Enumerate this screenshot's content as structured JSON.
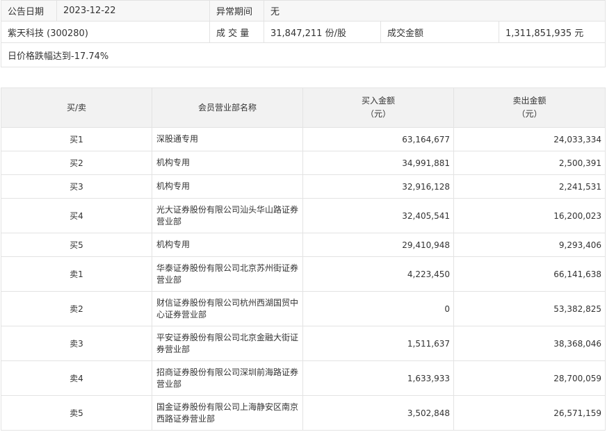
{
  "info": {
    "date_label": "公告日期",
    "date_value": "2023-12-22",
    "period_label": "异常期间",
    "period_value": "无",
    "stock_name": "紫天科技 (300280)",
    "volume_label": "成 交 量",
    "volume_value": "31,847,211 份/股",
    "amount_label": "成交金额",
    "amount_value": "1,311,851,935 元",
    "note": "日价格跌幅达到-17.74%"
  },
  "table": {
    "headers": {
      "side": "买/卖",
      "branch": "会员营业部名称",
      "buy_line1": "买入金额",
      "buy_line2": "（元）",
      "sell_line1": "卖出金额",
      "sell_line2": "（元）"
    },
    "rows": [
      {
        "side": "买1",
        "branch": "深股通专用",
        "buy": "63,164,677",
        "sell": "24,033,334"
      },
      {
        "side": "买2",
        "branch": "机构专用",
        "buy": "34,991,881",
        "sell": "2,500,391"
      },
      {
        "side": "买3",
        "branch": "机构专用",
        "buy": "32,916,128",
        "sell": "2,241,531"
      },
      {
        "side": "买4",
        "branch": "光大证券股份有限公司汕头华山路证券营业部",
        "buy": "32,405,541",
        "sell": "16,200,023"
      },
      {
        "side": "买5",
        "branch": "机构专用",
        "buy": "29,410,948",
        "sell": "9,293,406"
      },
      {
        "side": "卖1",
        "branch": "华泰证券股份有限公司北京苏州街证券营业部",
        "buy": "4,223,450",
        "sell": "66,141,638"
      },
      {
        "side": "卖2",
        "branch": "财信证券股份有限公司杭州西湖国贸中心证券营业部",
        "buy": "0",
        "sell": "53,382,825"
      },
      {
        "side": "卖3",
        "branch": "平安证券股份有限公司北京金融大街证券营业部",
        "buy": "1,511,637",
        "sell": "38,368,046"
      },
      {
        "side": "卖4",
        "branch": "招商证券股份有限公司深圳前海路证券营业部",
        "buy": "1,633,933",
        "sell": "28,700,059"
      },
      {
        "side": "卖5",
        "branch": "国金证券股份有限公司上海静安区南京西路证券营业部",
        "buy": "3,502,848",
        "sell": "26,571,159"
      }
    ]
  }
}
